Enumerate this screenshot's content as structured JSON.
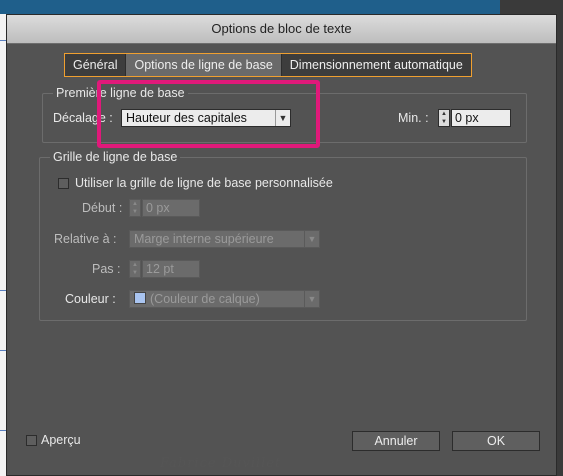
{
  "dialog": {
    "title": "Options de bloc de texte"
  },
  "tabs": [
    {
      "label": "Général",
      "active": false
    },
    {
      "label": "Options de ligne de base",
      "active": true
    },
    {
      "label": "Dimensionnement automatique",
      "active": false
    }
  ],
  "first_baseline": {
    "group_title": "Première ligne de base",
    "offset_label": "Décalage :",
    "offset_value": "Hauteur des capitales",
    "min_label": "Min. :",
    "min_value": "0 px"
  },
  "baseline_grid": {
    "group_title": "Grille de ligne de base",
    "custom_checkbox_label": "Utiliser la grille de ligne de base personnalisée",
    "start_label": "Début :",
    "start_value": "0 px",
    "relative_label": "Relative à :",
    "relative_value": "Marge interne supérieure",
    "increment_label": "Pas :",
    "increment_value": "12 pt",
    "color_label": "Couleur :",
    "color_value": "(Couleur de calque)",
    "color_swatch": "#a9c4f0"
  },
  "footer": {
    "preview_label": "Aperçu",
    "cancel_label": "Annuler",
    "ok_label": "OK"
  },
  "colors": {
    "highlight": "#e0197a",
    "tab_border": "#f0a030"
  }
}
